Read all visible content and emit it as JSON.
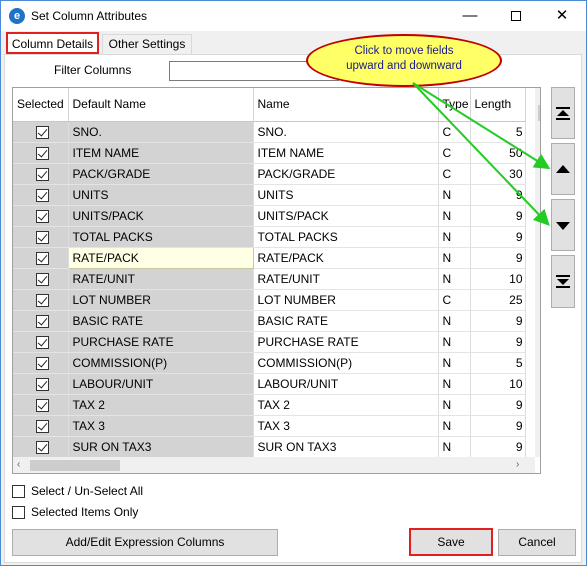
{
  "window": {
    "title": "Set Column Attributes"
  },
  "tabs": [
    {
      "label": "Column Details"
    },
    {
      "label": "Other Settings"
    }
  ],
  "filter": {
    "label": "Filter Columns",
    "value": ""
  },
  "callout": {
    "line1": "Click  to  move  fields",
    "line2": "upward  and  downward"
  },
  "grid": {
    "headers": [
      "Selected",
      "Default Name",
      "Name",
      "Type",
      "Length"
    ],
    "rows": [
      {
        "selected": true,
        "default_name": "SNO.",
        "name": "SNO.",
        "type": "C",
        "length": "5"
      },
      {
        "selected": true,
        "default_name": "ITEM NAME",
        "name": "ITEM NAME",
        "type": "C",
        "length": "50"
      },
      {
        "selected": true,
        "default_name": "PACK/GRADE",
        "name": "PACK/GRADE",
        "type": "C",
        "length": "30"
      },
      {
        "selected": true,
        "default_name": "UNITS",
        "name": "UNITS",
        "type": "N",
        "length": "9"
      },
      {
        "selected": true,
        "default_name": "UNITS/PACK",
        "name": "UNITS/PACK",
        "type": "N",
        "length": "9"
      },
      {
        "selected": true,
        "default_name": "TOTAL PACKS",
        "name": "TOTAL PACKS",
        "type": "N",
        "length": "9"
      },
      {
        "selected": true,
        "default_name": "RATE/PACK",
        "name": "RATE/PACK",
        "type": "N",
        "length": "9",
        "highlighted": true
      },
      {
        "selected": true,
        "default_name": "RATE/UNIT",
        "name": "RATE/UNIT",
        "type": "N",
        "length": "10"
      },
      {
        "selected": true,
        "default_name": "LOT NUMBER",
        "name": "LOT NUMBER",
        "type": "C",
        "length": "25"
      },
      {
        "selected": true,
        "default_name": "BASIC RATE",
        "name": "BASIC RATE",
        "type": "N",
        "length": "9"
      },
      {
        "selected": true,
        "default_name": "PURCHASE RATE",
        "name": "PURCHASE RATE",
        "type": "N",
        "length": "9"
      },
      {
        "selected": true,
        "default_name": "COMMISSION(P)",
        "name": "COMMISSION(P)",
        "type": "N",
        "length": "5"
      },
      {
        "selected": true,
        "default_name": "LABOUR/UNIT",
        "name": "LABOUR/UNIT",
        "type": "N",
        "length": "10"
      },
      {
        "selected": true,
        "default_name": "TAX 2",
        "name": "TAX 2",
        "type": "N",
        "length": "9"
      },
      {
        "selected": true,
        "default_name": "TAX 3",
        "name": "TAX 3",
        "type": "N",
        "length": "9"
      },
      {
        "selected": true,
        "default_name": "SUR ON TAX3",
        "name": "SUR ON TAX3",
        "type": "N",
        "length": "9"
      }
    ]
  },
  "move_buttons": {
    "top_icon": "move-to-top-icon",
    "up_icon": "move-up-icon",
    "down_icon": "move-down-icon",
    "bottom_icon": "move-to-bottom-icon"
  },
  "options": {
    "select_all": "Select / Un-Select All",
    "selected_only": "Selected Items Only"
  },
  "buttons": {
    "expression": "Add/Edit Expression Columns",
    "save": "Save",
    "cancel": "Cancel"
  },
  "colors": {
    "selected_cell_bg": "#d3d3d3",
    "callout_bg": "#ffff66",
    "callout_border": "#c00000",
    "annotation_arrow": "#22cc22",
    "highlight_border": "#e02020"
  }
}
